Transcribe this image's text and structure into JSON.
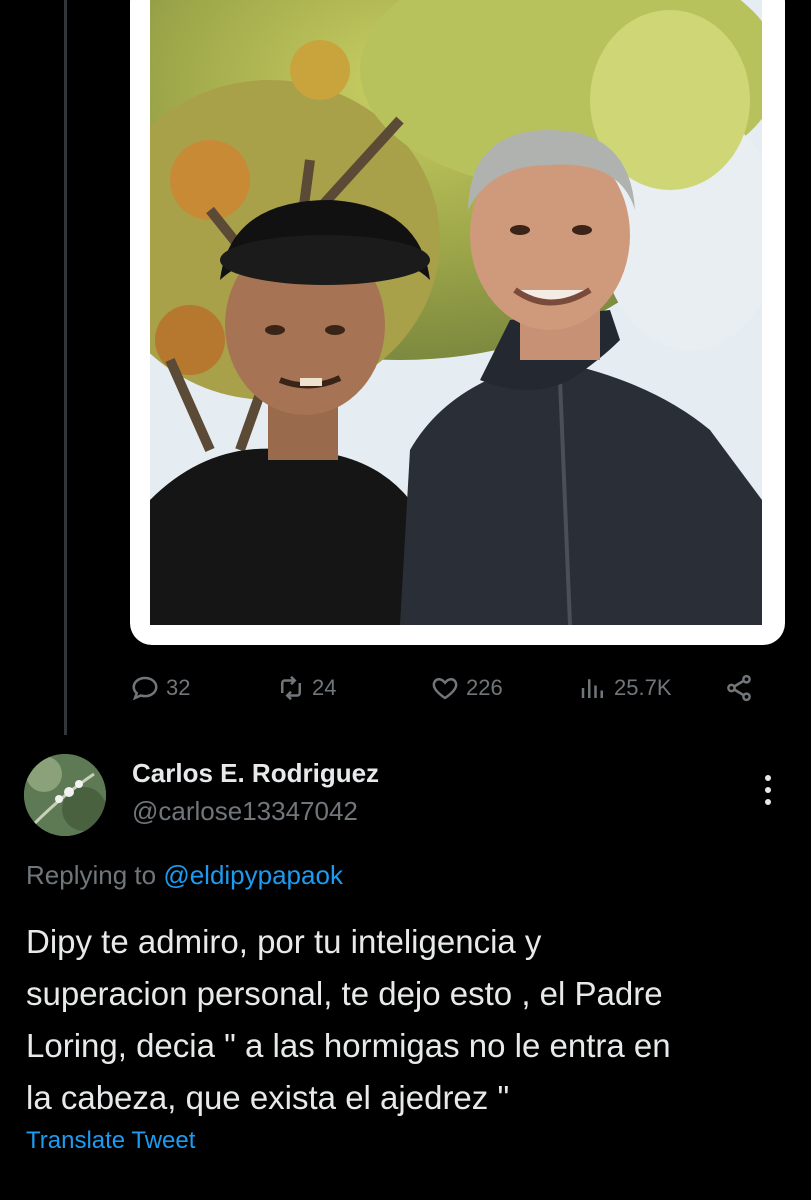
{
  "tweet": {
    "image_alt": "selfie-of-two-men-under-autumn-tree",
    "stats": {
      "replies": "32",
      "retweets": "24",
      "likes": "226",
      "views": "25.7K"
    }
  },
  "reply": {
    "author_name": "Carlos E. Rodriguez",
    "author_handle": "@carlose13347042",
    "replying_prefix": "Replying to ",
    "replying_to": "@eldipypapaok",
    "text": "Dipy te admiro, por tu inteligencia y\nsuperacion personal, te dejo esto , el Padre\nLoring, decia \" a las hormigas no le entra en\nla cabeza, que exista el ajedrez \"",
    "translate_label": "Translate Tweet"
  },
  "colors": {
    "background": "#000000",
    "text": "#e7e9ea",
    "muted": "#71767b",
    "accent": "#1d9bf0"
  },
  "icons": {
    "reply": "speech-bubble-icon",
    "retweet": "retweet-icon",
    "like": "heart-icon",
    "views": "bar-chart-icon",
    "share": "share-icon",
    "more": "vertical-dots-icon"
  }
}
